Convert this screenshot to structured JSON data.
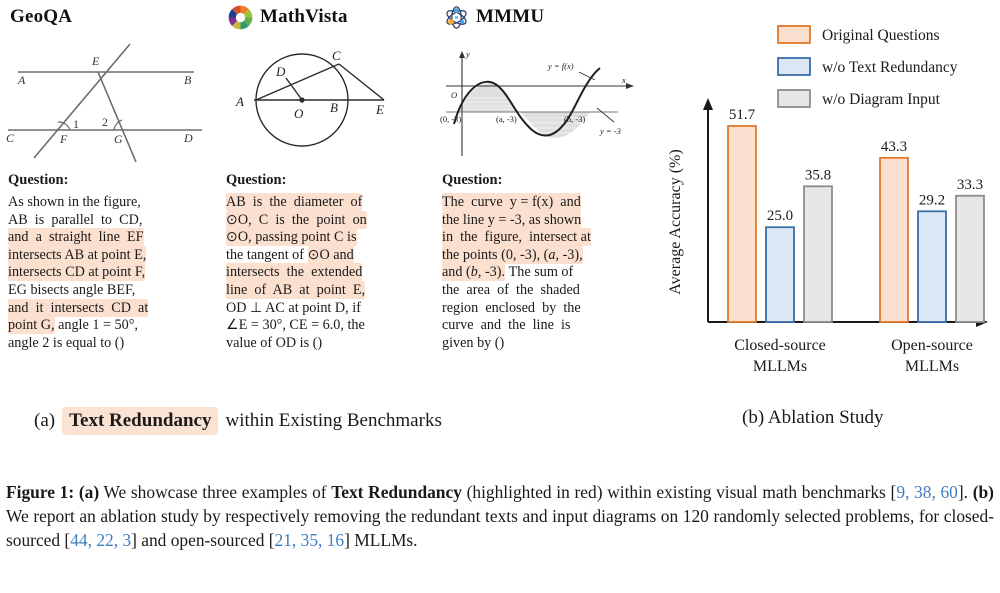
{
  "benchmarks": [
    {
      "name": "GeoQA",
      "logo": "none",
      "question_label": "Question:",
      "lines": [
        [
          {
            "t": "As shown in the figure,",
            "h": false
          }
        ],
        [
          {
            "t": "AB is parallel to CD,",
            "h": false
          }
        ],
        [
          {
            "t": "and a straight line EF",
            "h": true
          }
        ],
        [
          {
            "t": "intersects AB at point E,",
            "h": true
          }
        ],
        [
          {
            "t": "intersects CD at point F,",
            "h": true
          }
        ],
        [
          {
            "t": "EG bisects angle BEF,",
            "h": false
          }
        ],
        [
          {
            "t": "and it intersects CD at",
            "h": true
          }
        ],
        [
          {
            "t": "point G,",
            "h": true
          },
          {
            "t": " angle 1 = 50°,",
            "h": false
          }
        ],
        [
          {
            "t": "angle 2 is equal to ()",
            "h": false
          }
        ]
      ],
      "diagram_labels": [
        "A",
        "B",
        "C",
        "D",
        "E",
        "F",
        "G",
        "1",
        "2"
      ]
    },
    {
      "name": "MathVista",
      "logo": "mathvista-pinwheel-logo",
      "question_label": "Question:",
      "lines": [
        [
          {
            "t": "AB is the diameter of",
            "h": true
          }
        ],
        [
          {
            "t": "⊙O, C is the point on",
            "h": true
          }
        ],
        [
          {
            "t": "⊙O, passing point C is",
            "h": true
          }
        ],
        [
          {
            "t": "the tangent of ⊙O and",
            "h": true
          }
        ],
        [
          {
            "t": "intersects the extended",
            "h": true
          }
        ],
        [
          {
            "t": "line of AB at point E,",
            "h": true
          }
        ],
        [
          {
            "t": "OD ⊥ AC at point D, if",
            "h": false
          }
        ],
        [
          {
            "t": "∠E = 30°, CE = 6.0, the",
            "h": false
          }
        ],
        [
          {
            "t": "value of OD is ()",
            "h": false
          }
        ]
      ],
      "diagram_labels": [
        "A",
        "B",
        "C",
        "D",
        "E",
        "O"
      ]
    },
    {
      "name": "MMMU",
      "logo": "mmmu-atom-logo",
      "question_label": "Question:",
      "lines": [
        [
          {
            "t": "The curve y = f(x) and",
            "h": true
          }
        ],
        [
          {
            "t": "the line y = -3, as shown",
            "h": true
          }
        ],
        [
          {
            "t": "in the figure, intersect at",
            "h": true
          }
        ],
        [
          {
            "t": "the points (0, -3), (a, -3),",
            "h": true
          }
        ],
        [
          {
            "t": "and (b, -3).",
            "h": true
          },
          {
            "t": " The sum of",
            "h": false
          }
        ],
        [
          {
            "t": "the area of the shaded",
            "h": false
          }
        ],
        [
          {
            "t": "region enclosed by the",
            "h": false
          }
        ],
        [
          {
            "t": "curve and the line is",
            "h": false
          }
        ],
        [
          {
            "t": "given by ()",
            "h": false
          }
        ]
      ],
      "diagram_labels": [
        "y",
        "x",
        "O",
        "y = f(x)",
        "y = -3",
        "(0, -3)",
        "(a, -3)",
        "(b, -3)"
      ]
    }
  ],
  "chart_data": {
    "type": "bar",
    "title": "",
    "xlabel": "",
    "ylabel": "Average Accuracy (%)",
    "ylim": [
      0,
      60
    ],
    "grid": false,
    "legend_position": "top-right",
    "categories": [
      "Closed-source MLLMs",
      "Open-source MLLMs"
    ],
    "category_lines": [
      [
        "Closed-source",
        "MLLMs"
      ],
      [
        "Open-source",
        "MLLMs"
      ]
    ],
    "series": [
      {
        "name": "Original Questions",
        "values": [
          51.7,
          43.3
        ],
        "fill": "#fbe0d0",
        "stroke": "#e1792a"
      },
      {
        "name": "w/o Text Redundancy",
        "values": [
          25.0,
          29.2
        ],
        "fill": "#dbe7f5",
        "stroke": "#3a6ea8"
      },
      {
        "name": "w/o Diagram Input",
        "values": [
          35.8,
          33.3
        ],
        "fill": "#e6e6e6",
        "stroke": "#8c8c8c"
      }
    ],
    "value_labels": [
      "51.7",
      "25.0",
      "35.8",
      "43.3",
      "29.2",
      "33.3"
    ]
  },
  "subcaptions": {
    "a_prefix": "(a)",
    "a_highlight": "Text Redundancy",
    "a_rest": "within Existing Benchmarks",
    "b": "(b)  Ablation Study"
  },
  "caption": {
    "figure_label": "Figure 1:",
    "part_a_bold": "(a)",
    "seg1": " We showcase three examples of ",
    "bold1": "Text Redundancy",
    "seg2": " (highlighted in red) within existing visual math benchmarks [",
    "refs1": "9, 38, 60",
    "seg3": "]. ",
    "part_b_bold": "(b)",
    "seg4": " We report an ablation study by respectively removing the redundant texts and input diagrams on 120 randomly selected problems, for closed-sourced [",
    "refs2": "44, 22, 3",
    "seg5": "] and open-sourced [",
    "refs3": "21, 35, 16",
    "seg6": "] MLLMs."
  },
  "colors": {
    "highlight": "#fbe0d0",
    "orange": "#e1792a",
    "blue": "#3a6ea8",
    "gray": "#8c8c8c",
    "reference_link": "#3f7fbf"
  }
}
